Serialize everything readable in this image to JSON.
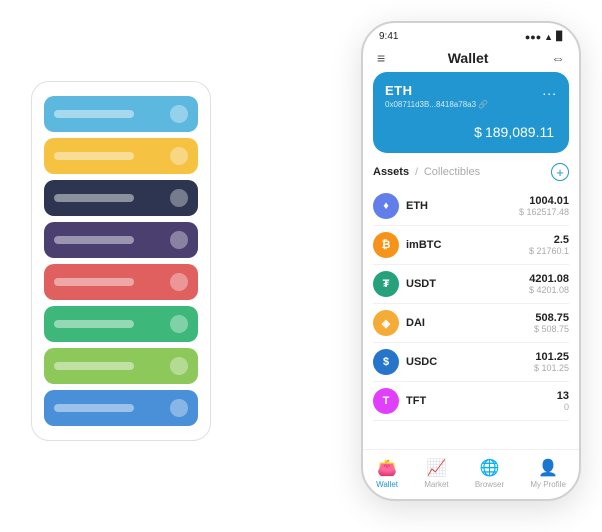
{
  "status_bar": {
    "time": "9:41",
    "signal": "●●●",
    "wifi": "▲",
    "battery": "▉"
  },
  "header": {
    "menu_icon": "≡",
    "title": "Wallet",
    "expand_icon": "⇔"
  },
  "eth_card": {
    "symbol": "ETH",
    "address": "0x08711d3B...8418a78a3",
    "address_extra": "🔗",
    "more_icon": "...",
    "balance_prefix": "$",
    "balance": "189,089.11"
  },
  "assets_tabs": {
    "active": "Assets",
    "separator": "/",
    "inactive": "Collectibles",
    "add_icon": "+"
  },
  "assets": [
    {
      "symbol": "ETH",
      "icon_char": "♦",
      "icon_color": "#627EEA",
      "amount": "1004.01",
      "usd": "$ 162517.48"
    },
    {
      "symbol": "imBTC",
      "icon_char": "₿",
      "icon_color": "#F7931A",
      "amount": "2.5",
      "usd": "$ 21760.1"
    },
    {
      "symbol": "USDT",
      "icon_char": "₮",
      "icon_color": "#26A17B",
      "amount": "4201.08",
      "usd": "$ 4201.08"
    },
    {
      "symbol": "DAI",
      "icon_char": "◈",
      "icon_color": "#F5AC37",
      "amount": "508.75",
      "usd": "$ 508.75"
    },
    {
      "symbol": "USDC",
      "icon_char": "$",
      "icon_color": "#2775CA",
      "amount": "101.25",
      "usd": "$ 101.25"
    },
    {
      "symbol": "TFT",
      "icon_char": "T",
      "icon_color": "#e040fb",
      "amount": "13",
      "usd": "0"
    }
  ],
  "bottom_nav": [
    {
      "label": "Wallet",
      "icon": "👛",
      "active": true
    },
    {
      "label": "Market",
      "icon": "📈",
      "active": false
    },
    {
      "label": "Browser",
      "icon": "🌐",
      "active": false
    },
    {
      "label": "My Profile",
      "icon": "👤",
      "active": false
    }
  ],
  "card_stack": [
    {
      "color": "#5db8e0"
    },
    {
      "color": "#f5c242"
    },
    {
      "color": "#2d3550"
    },
    {
      "color": "#4a3f6e"
    },
    {
      "color": "#e06060"
    },
    {
      "color": "#3db87a"
    },
    {
      "color": "#8dc85a"
    },
    {
      "color": "#4a90d9"
    }
  ]
}
